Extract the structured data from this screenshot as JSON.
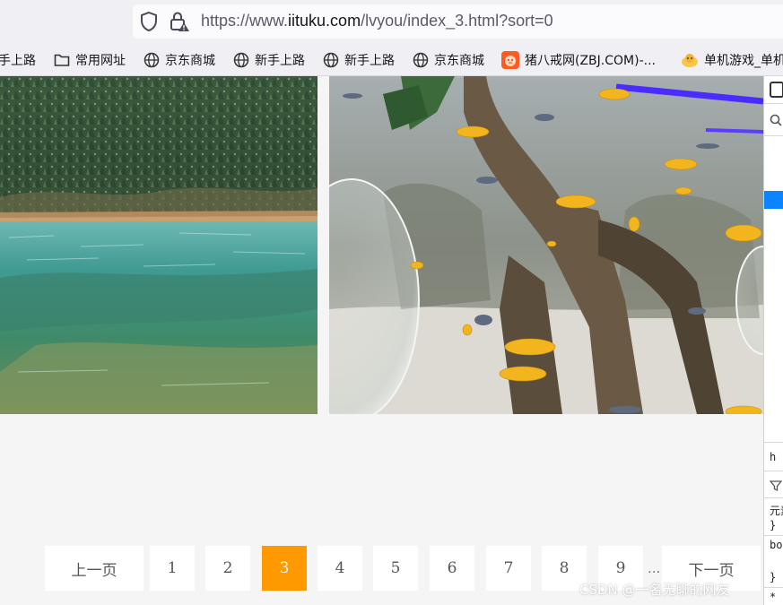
{
  "browser": {
    "url_prefix": "https://www.",
    "url_host": "iituku.com",
    "url_path": "/lvyou/index_3.html?sort=0"
  },
  "bookmarks": [
    {
      "label": "手上路",
      "icon": "globe-icon"
    },
    {
      "label": "常用网址",
      "icon": "folder-icon"
    },
    {
      "label": "京东商城",
      "icon": "globe-icon"
    },
    {
      "label": "新手上路",
      "icon": "globe-icon"
    },
    {
      "label": "新手上路",
      "icon": "globe-icon"
    },
    {
      "label": "京东商城",
      "icon": "globe-icon"
    },
    {
      "label": "猪八戒网(ZBJ.COM)-...",
      "icon": "zbj-logo-icon"
    },
    {
      "label": "单机游戏_单机",
      "icon": "game-logo-icon"
    }
  ],
  "devtools": {
    "text_1": "元素",
    "text_2": "}",
    "text_3": "bo",
    "text_4": "}",
    "text_5": "*",
    "text_h": "h"
  },
  "pagination": {
    "prev": "上一页",
    "pages": [
      "1",
      "2",
      "3",
      "4",
      "5",
      "6",
      "7",
      "8",
      "9"
    ],
    "current": "3",
    "ellipsis": "...",
    "next": "下一页",
    "active_color": "#ff9900"
  },
  "watermark": "CSDN @一名无聊的网友"
}
